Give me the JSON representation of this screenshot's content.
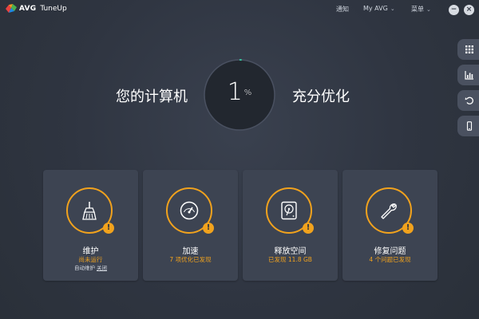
{
  "titlebar": {
    "brand": "AVG",
    "product": "TuneUp",
    "nav": [
      {
        "label": "通知"
      },
      {
        "label": "My AVG"
      },
      {
        "label": "菜单"
      }
    ],
    "window_controls": {
      "minimize": "−",
      "close": "×"
    }
  },
  "side_tools": [
    {
      "icon": "grid-icon"
    },
    {
      "icon": "bar-chart-icon"
    },
    {
      "icon": "undo-icon"
    },
    {
      "icon": "mobile-icon"
    }
  ],
  "headline": {
    "left_text": "您的计算机",
    "right_text": "充分优化",
    "value": "1",
    "unit": "%",
    "progress": 0.01
  },
  "cards": [
    {
      "title": "维护",
      "status": "尚未运行",
      "sub_prefix": "自动维护",
      "sub_link": "关闭",
      "icon": "broom-icon",
      "alert": "!"
    },
    {
      "title": "加速",
      "status": "7 项优化已发现",
      "icon": "speedometer-icon",
      "alert": "!"
    },
    {
      "title": "释放空间",
      "status": "已发现 11.8 GB",
      "icon": "hard-drive-icon",
      "alert": "!"
    },
    {
      "title": "修复问题",
      "status": "4 个问题已发现",
      "icon": "wrench-icon",
      "alert": "!"
    }
  ],
  "colors": {
    "accent": "#f1a21d",
    "background": "#2f3541",
    "card": "#3d4452"
  }
}
